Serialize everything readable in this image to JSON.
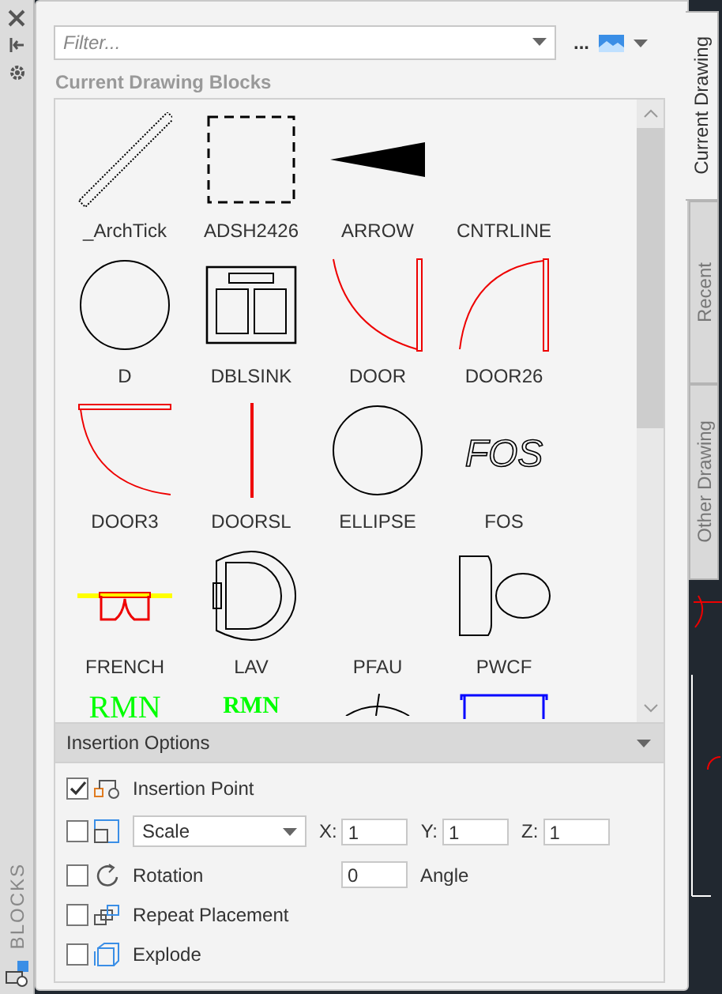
{
  "sidebar": {
    "title": "BLOCKS"
  },
  "toolbar": {
    "filter": {
      "placeholder": "Filter..."
    },
    "more": "..."
  },
  "section_title": "Current Drawing Blocks",
  "blocks": [
    {
      "kind": "archtick",
      "label": "_ArchTick"
    },
    {
      "kind": "dashed-square",
      "label": "ADSH2426"
    },
    {
      "kind": "arrow",
      "label": "ARROW"
    },
    {
      "kind": "blank",
      "label": "CNTRLINE"
    },
    {
      "kind": "circle",
      "label": "D"
    },
    {
      "kind": "dblsink",
      "label": "DBLSINK"
    },
    {
      "kind": "door",
      "label": "DOOR"
    },
    {
      "kind": "door26",
      "label": "DOOR26"
    },
    {
      "kind": "door3",
      "label": "DOOR3"
    },
    {
      "kind": "doorsl",
      "label": "DOORSL"
    },
    {
      "kind": "circle",
      "label": "ELLIPSE"
    },
    {
      "kind": "text",
      "preview_text": "FOS",
      "label": "FOS"
    },
    {
      "kind": "french",
      "label": "FRENCH"
    },
    {
      "kind": "lav",
      "label": "LAV"
    },
    {
      "kind": "blank",
      "label": "PFAU"
    },
    {
      "kind": "pwcf",
      "label": "PWCF"
    },
    {
      "kind": "green-serif-text",
      "preview_text": "RMN"
    },
    {
      "kind": "green-bold-text",
      "preview_text": "RMN"
    },
    {
      "kind": "cut-circle"
    },
    {
      "kind": "blue-frame"
    }
  ],
  "insertion_options": {
    "title": "Insertion Options",
    "rows": [
      {
        "kind": "plain",
        "label": "Insertion Point",
        "checked": true
      },
      {
        "kind": "scale",
        "select": "Scale",
        "checked": false,
        "fields": [
          {
            "label": "X:",
            "value": "1"
          },
          {
            "label": "Y:",
            "value": "1"
          },
          {
            "label": "Z:",
            "value": "1"
          }
        ]
      },
      {
        "kind": "rotation",
        "label": "Rotation",
        "checked": false,
        "value": "0",
        "unit": "Angle"
      },
      {
        "kind": "plain",
        "label": "Repeat Placement",
        "checked": false
      },
      {
        "kind": "plain",
        "label": "Explode",
        "checked": false
      }
    ]
  },
  "tabs": [
    {
      "label": "Current Drawing",
      "selected": true
    },
    {
      "label": "Recent",
      "selected": false
    },
    {
      "label": "Other Drawing",
      "selected": false
    }
  ]
}
